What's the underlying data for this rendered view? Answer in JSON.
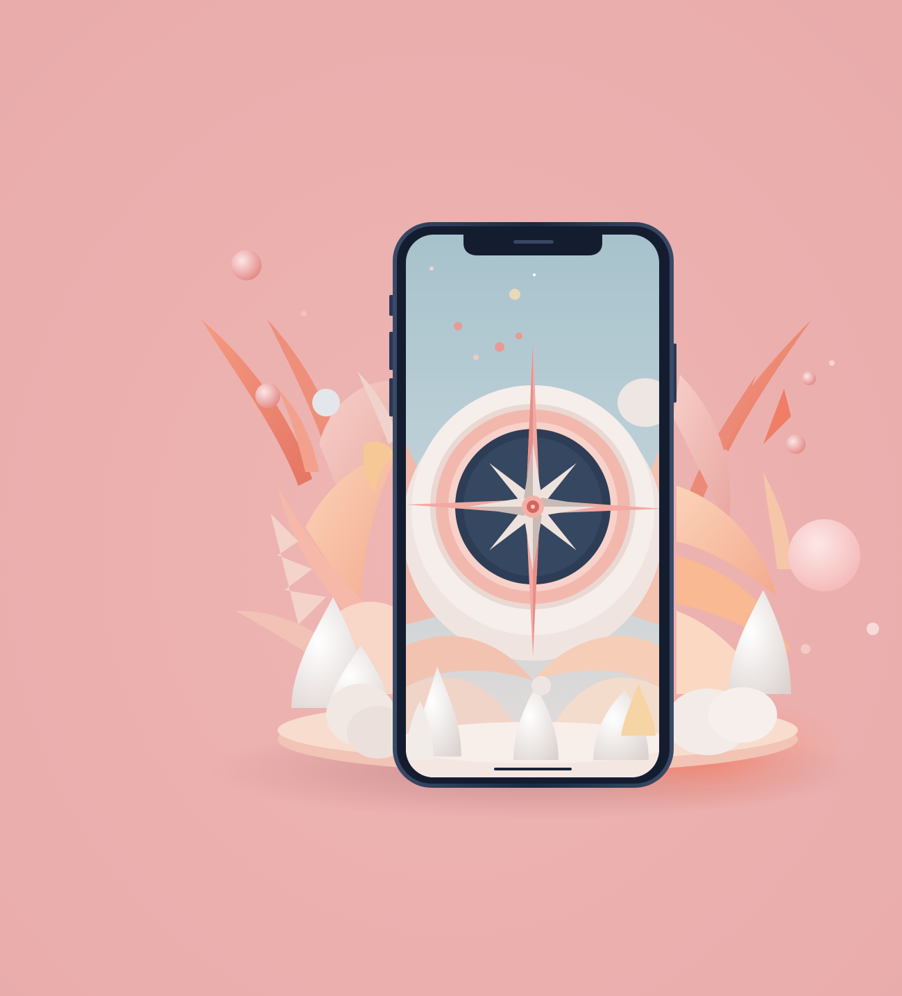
{
  "scene": {
    "subject": "smartphone-with-compass-wallpaper",
    "style": "3d-paper-craft-illustration"
  },
  "palette": {
    "background": "#ebb1b0",
    "phone_frame": "#1f2c46",
    "screen_sky_top": "#9fbcc8",
    "screen_sky_bottom": "#c5d5db",
    "compass_dark": "#2d3d55",
    "petal_coral": "#f08a74",
    "petal_peach": "#f6c1a3",
    "cream": "#f4ece6",
    "glow": "#ff6a4a"
  },
  "icons": {
    "notch": "phone-notch",
    "compass": "compass-rose-icon",
    "home_indicator": "home-indicator"
  }
}
